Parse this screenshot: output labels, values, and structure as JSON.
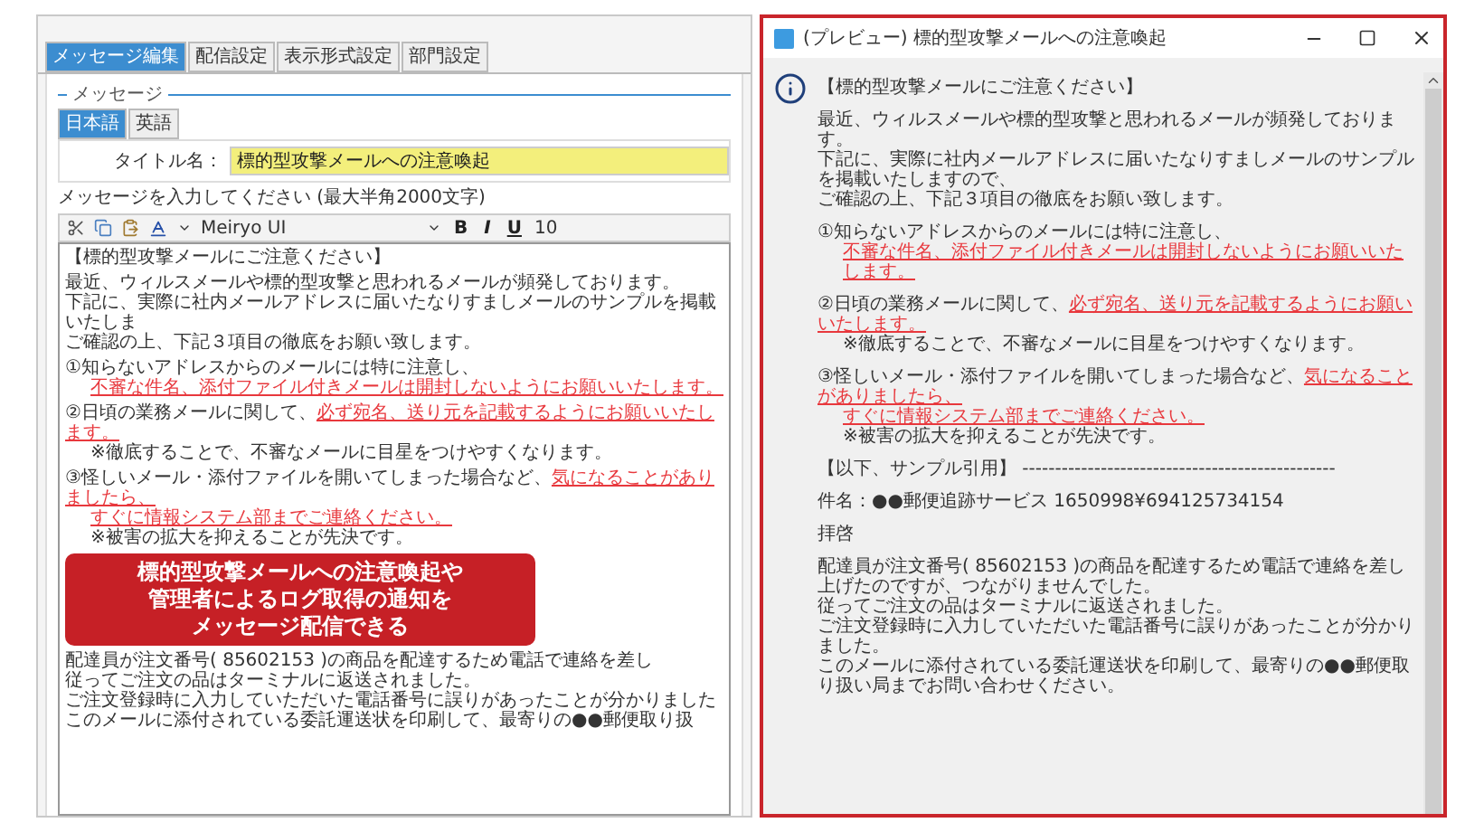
{
  "tabs": [
    {
      "label": "メッセージ編集",
      "selected": true
    },
    {
      "label": "配信設定",
      "selected": false
    },
    {
      "label": "表示形式設定",
      "selected": false
    },
    {
      "label": "部門設定",
      "selected": false
    }
  ],
  "message_section": {
    "legend": "メッセージ",
    "language_tabs": [
      {
        "label": "日本語",
        "selected": true
      },
      {
        "label": "英語",
        "selected": false
      }
    ],
    "title_label": "タイトル名：",
    "title_value": "標的型攻撃メールへの注意喚起",
    "prompt": "メッセージを入力してください (最大半角2000文字)",
    "toolbar": {
      "font": "Meiryo UI",
      "format_buttons": [
        "B",
        "I",
        "U"
      ],
      "size": "10"
    },
    "editor_top": [
      [
        {
          "indented": false,
          "segments": [
            {
              "text": "【標的型攻撃メールにご注意ください】",
              "warning": false
            }
          ]
        }
      ],
      [
        {
          "indented": false,
          "segments": [
            {
              "text": "最近、ウィルスメールや標的型攻撃と思われるメールが頻発しております。",
              "warning": false
            }
          ]
        },
        {
          "indented": false,
          "segments": [
            {
              "text": "下記に、実際に社内メールアドレスに届いたなりすましメールのサンプルを掲載いたしま",
              "warning": false
            }
          ]
        },
        {
          "indented": false,
          "segments": [
            {
              "text": "ご確認の上、下記３項目の徹底をお願い致します。",
              "warning": false
            }
          ]
        }
      ],
      [
        {
          "indented": false,
          "segments": [
            {
              "text": "①知らないアドレスからのメールには特に注意し、",
              "warning": false
            }
          ]
        },
        {
          "indented": true,
          "segments": [
            {
              "text": "不審な件名、添付ファイル付きメールは開封しないようにお願いいたします。",
              "warning": true
            }
          ]
        }
      ],
      [
        {
          "indented": false,
          "segments": [
            {
              "text": "②日頃の業務メールに関して、",
              "warning": false
            },
            {
              "text": "必ず宛名、送り元を記載するようにお願いいたします。",
              "warning": true
            }
          ]
        },
        {
          "indented": true,
          "segments": [
            {
              "text": "※徹底することで、不審なメールに目星をつけやすくなります。",
              "warning": false
            }
          ]
        }
      ],
      [
        {
          "indented": false,
          "segments": [
            {
              "text": "③怪しいメール・添付ファイルを開いてしまった場合など、",
              "warning": false
            },
            {
              "text": "気になることがありましたら、",
              "warning": true
            }
          ]
        },
        {
          "indented": true,
          "segments": [
            {
              "text": "すぐに情報システム部までご連絡ください。",
              "warning": true
            }
          ]
        },
        {
          "indented": true,
          "segments": [
            {
              "text": "※被害の拡大を抑えることが先決です。",
              "warning": false
            }
          ]
        }
      ]
    ],
    "callout": [
      "標的型攻撃メールへの注意喚起や",
      "管理者によるログ取得の通知を",
      "メッセージ配信できる"
    ],
    "editor_bottom": [
      [
        {
          "indented": false,
          "segments": [
            {
              "text": "配達員が注文番号( 85602153 )の商品を配達するため電話で連絡を差し",
              "warning": false
            }
          ]
        },
        {
          "indented": false,
          "segments": [
            {
              "text": "従ってご注文の品はターミナルに返送されました。",
              "warning": false
            }
          ]
        },
        {
          "indented": false,
          "segments": [
            {
              "text": "ご注文登録時に入力していただいた電話番号に誤りがあったことが分かりました",
              "warning": false
            }
          ]
        },
        {
          "indented": false,
          "segments": [
            {
              "text": "このメールに添付されている委託運送状を印刷して、最寄りの●●郵便取り扱",
              "warning": false
            }
          ]
        }
      ]
    ]
  },
  "preview": {
    "title": "(プレビュー) 標的型攻撃メールへの注意喚起",
    "paragraphs": [
      [
        {
          "indented": false,
          "segments": [
            {
              "text": "【標的型攻撃メールにご注意ください】",
              "warning": false
            }
          ]
        }
      ],
      [
        {
          "indented": false,
          "segments": [
            {
              "text": "最近、ウィルスメールや標的型攻撃と思われるメールが頻発しております。",
              "warning": false
            }
          ]
        },
        {
          "indented": false,
          "segments": [
            {
              "text": "下記に、実際に社内メールアドレスに届いたなりすましメールのサンプルを掲載いたしますので、",
              "warning": false
            }
          ]
        },
        {
          "indented": false,
          "segments": [
            {
              "text": "ご確認の上、下記３項目の徹底をお願い致します。",
              "warning": false
            }
          ]
        }
      ],
      [
        {
          "indented": false,
          "segments": [
            {
              "text": "①知らないアドレスからのメールには特に注意し、",
              "warning": false
            }
          ]
        },
        {
          "indented": true,
          "segments": [
            {
              "text": "不審な件名、添付ファイル付きメールは開封しないようにお願いいたします。",
              "warning": true
            }
          ]
        }
      ],
      [
        {
          "indented": false,
          "segments": [
            {
              "text": "②日頃の業務メールに関して、",
              "warning": false
            },
            {
              "text": "必ず宛名、送り元を記載するようにお願いいたします。",
              "warning": true
            }
          ]
        },
        {
          "indented": true,
          "segments": [
            {
              "text": "※徹底することで、不審なメールに目星をつけやすくなります。",
              "warning": false
            }
          ]
        }
      ],
      [
        {
          "indented": false,
          "segments": [
            {
              "text": "③怪しいメール・添付ファイルを開いてしまった場合など、",
              "warning": false
            },
            {
              "text": "気になることがありましたら、",
              "warning": true
            }
          ]
        },
        {
          "indented": true,
          "segments": [
            {
              "text": "すぐに情報システム部までご連絡ください。",
              "warning": true
            }
          ]
        },
        {
          "indented": true,
          "segments": [
            {
              "text": "※被害の拡大を抑えることが先決です。",
              "warning": false
            }
          ]
        }
      ],
      [
        {
          "indented": false,
          "segments": [
            {
              "text": "【以下、サンプル引用】 ------------------------------------------------",
              "warning": false
            }
          ]
        }
      ],
      [
        {
          "indented": false,
          "segments": [
            {
              "text": "件名：●●郵便追跡サービス 1650998¥694125734154",
              "warning": false
            }
          ]
        }
      ],
      [
        {
          "indented": false,
          "segments": [
            {
              "text": "拝啓",
              "warning": false
            }
          ]
        }
      ],
      [
        {
          "indented": false,
          "segments": [
            {
              "text": "配達員が注文番号( 85602153 )の商品を配達するため電話で連絡を差し上げたのですが、つながりませんでした。",
              "warning": false
            }
          ]
        },
        {
          "indented": false,
          "segments": [
            {
              "text": "従ってご注文の品はターミナルに返送されました。",
              "warning": false
            }
          ]
        },
        {
          "indented": false,
          "segments": [
            {
              "text": "ご注文登録時に入力していただいた電話番号に誤りがあったことが分かりました。",
              "warning": false
            }
          ]
        },
        {
          "indented": false,
          "segments": [
            {
              "text": "このメールに添付されている委託運送状を印刷して、最寄りの●●郵便取り扱い局までお問い合わせください。",
              "warning": false
            }
          ]
        }
      ]
    ]
  }
}
